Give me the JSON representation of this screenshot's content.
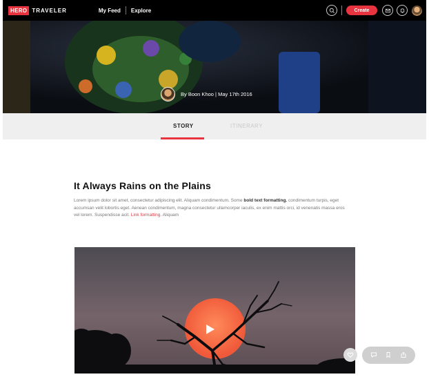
{
  "nav": {
    "logo_hero": "HERO",
    "logo_traveler": "TRAVELER",
    "links": [
      {
        "label": "My Feed"
      },
      {
        "label": "Explore"
      }
    ],
    "create_label": "Create",
    "icons": [
      "search-icon",
      "mail-icon",
      "bell-icon",
      "avatar"
    ]
  },
  "hero": {
    "byline": "By Boon Khoo | May 17th 2016"
  },
  "tabs": {
    "story": "STORY",
    "itinerary": "ITINERARY",
    "active": "STORY"
  },
  "article": {
    "title": "It Always Rains on the Plains",
    "body_part1": "Lorem ipsum dolor sit amet, consectetur adipiscing elit. Aliquam condimentum. Some ",
    "body_bold": "bold text formatting.",
    "body_part2": " condimentum turpis, eget accumsan velit lobortis eget. Aenean condimentum, magna consectetur ullamcorper iaculis, ex enim mattis orci, id venenatis massa eros vel lorem. Suspendisse acit. ",
    "body_link": "Link formatting.",
    "body_part3": " Aliquam"
  },
  "actions": {
    "icons": [
      "heart-icon",
      "comment-icon",
      "bookmark-icon",
      "share-icon"
    ]
  },
  "colors": {
    "accent": "#e8343f",
    "nav_bg": "#000000",
    "tab_bg": "#efefef"
  }
}
